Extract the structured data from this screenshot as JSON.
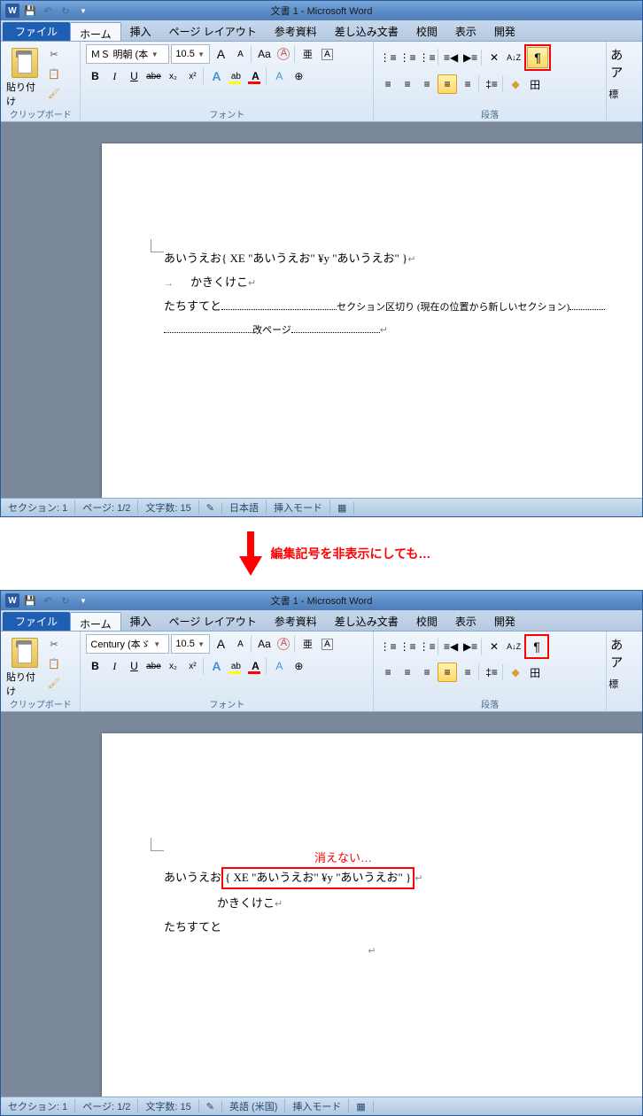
{
  "top": {
    "title": "文書 1 - Microsoft Word",
    "app_icon": "W",
    "tabs": {
      "file": "ファイル",
      "home": "ホーム",
      "insert": "挿入",
      "layout": "ページ レイアウト",
      "ref": "参考資料",
      "mail": "差し込み文書",
      "review": "校閲",
      "view": "表示",
      "dev": "開発"
    },
    "clipboard": {
      "paste": "貼り付け",
      "label": "クリップボード"
    },
    "font": {
      "name": "ＭＳ 明朝 (本",
      "size": "10.5",
      "label": "フォント",
      "grow": "A",
      "shrink": "A",
      "case": "Aa",
      "clear": "⊘",
      "ruby": "亜",
      "charbox": "A",
      "bold": "B",
      "italic": "I",
      "underline": "U",
      "strike": "abe",
      "sub": "x₂",
      "sup": "x²",
      "text_effects": "A",
      "highlight": "ab",
      "fontcolor": "A",
      "charscale": "A"
    },
    "para": {
      "label": "段落",
      "bullets": "≡",
      "numbers": "≡",
      "multilevel": "≡",
      "dec": "◀",
      "inc": "▶",
      "sort": "A↓Z",
      "pilcrow": "¶",
      "align_l": "≡",
      "align_c": "≡",
      "align_r": "≡",
      "justify": "≡",
      "linespace": "≡",
      "shading": "◆",
      "borders": "田"
    },
    "styles": {
      "item": "あア",
      "change": "標"
    },
    "doc": {
      "line1_text": "あいうえお",
      "fc1": "{  XE \"あいうえお\" ¥y \"あいうえお\" }",
      "p": "↵",
      "line2_text": "かきくけこ",
      "line3_text": "たちすてと",
      "section": "セクション区切り (現在の位置から新しいセクション)",
      "pagebreak": "改ページ"
    },
    "status": {
      "section": "セクション: 1",
      "page": "ページ: 1/2",
      "words": "文字数: 15",
      "lang": "日本語",
      "mode": "挿入モード"
    }
  },
  "mid": {
    "label": "編集記号を非表示にしても…"
  },
  "bot": {
    "title": "文書 1 - Microsoft Word",
    "font": {
      "name": "Century (本ゞ",
      "size": "10.5"
    },
    "doc": {
      "callout": "消えない…",
      "line1_text": "あいうえお",
      "fc1": "{  XE \"あいうえお\" ¥y \"あいうえお\"  }",
      "p": "↵",
      "line2_text": "かきくけこ",
      "line3_text": "たちすてと"
    },
    "status": {
      "section": "セクション: 1",
      "page": "ページ: 1/2",
      "words": "文字数: 15",
      "lang": "英語 (米国)",
      "mode": "挿入モード"
    }
  }
}
